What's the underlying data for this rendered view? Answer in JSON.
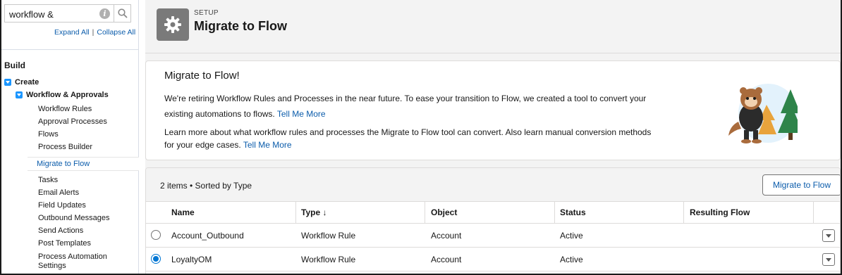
{
  "sidebar": {
    "search_value": "workflow &",
    "expand_all": "Expand All",
    "separator": "|",
    "collapse_all": "Collapse All",
    "build_heading": "Build",
    "create_label": "Create",
    "workflow_group_label": "Workflow & Approvals",
    "items_top": [
      "Workflow Rules",
      "Approval Processes",
      "Flows",
      "Process Builder"
    ],
    "selected_item": "Migrate to Flow",
    "items_bottom": [
      "Tasks",
      "Email Alerts",
      "Field Updates",
      "Outbound Messages",
      "Send Actions",
      "Post Templates",
      "Process Automation Settings"
    ],
    "selected_color": "#0b5cab"
  },
  "header": {
    "eyebrow": "SETUP",
    "title": "Migrate to Flow",
    "icon": "gear-icon"
  },
  "promo": {
    "title": "Migrate to Flow!",
    "p1_line1": "We're retiring Workflow Rules and Processes in the near future. To ease your transition to Flow, we created a tool to convert your",
    "p1_line2": "existing automations to flows.",
    "p1_link": "Tell Me More",
    "p2_line1": "Learn more about what workflow rules and processes the Migrate to Flow tool can convert. Also learn manual conversion methods",
    "p2_line2": "for your edge cases.",
    "p2_link": "Tell Me More",
    "illustration": "astro-mascot-with-trees"
  },
  "list": {
    "count_text": "2 items • Sorted by Type",
    "migrate_button": "Migrate to Flow",
    "columns": {
      "name": "Name",
      "type": "Type ↓",
      "object": "Object",
      "status": "Status",
      "resulting_flow": "Resulting Flow"
    },
    "rows": [
      {
        "selected": false,
        "name": "Account_Outbound",
        "type": "Workflow Rule",
        "object": "Account",
        "status": "Active",
        "resulting_flow": ""
      },
      {
        "selected": true,
        "name": "LoyaltyOM",
        "type": "Workflow Rule",
        "object": "Account",
        "status": "Active",
        "resulting_flow": ""
      }
    ],
    "accent_color": "#0176d3"
  }
}
